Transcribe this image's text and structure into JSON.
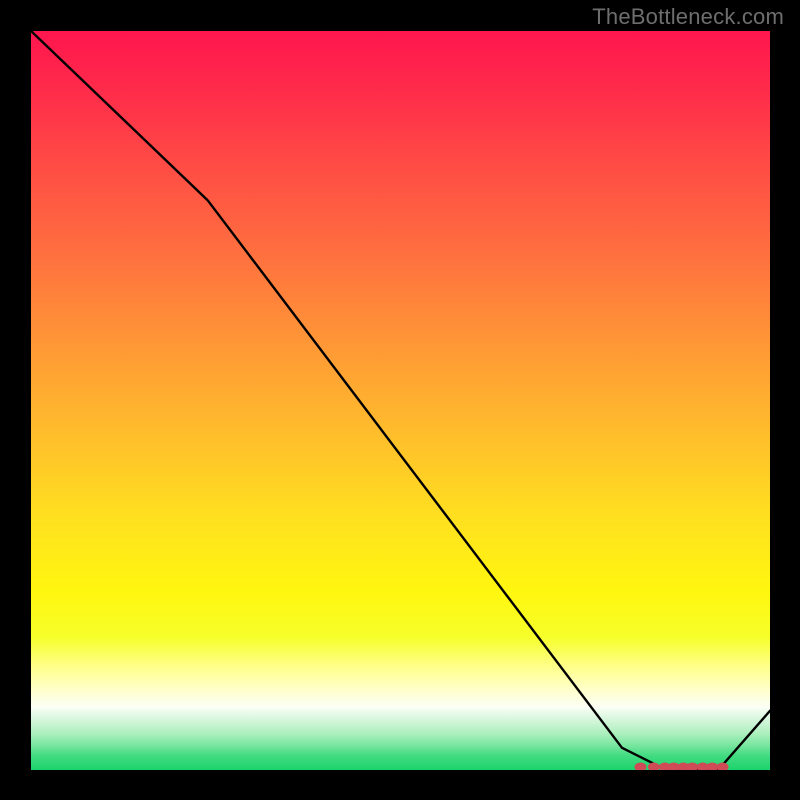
{
  "attribution": "TheBottleneck.com",
  "colors": {
    "gradient_stops": [
      {
        "offset": 0.0,
        "color": "#ff164e"
      },
      {
        "offset": 0.08,
        "color": "#ff2b4a"
      },
      {
        "offset": 0.18,
        "color": "#ff4b45"
      },
      {
        "offset": 0.3,
        "color": "#ff6f3f"
      },
      {
        "offset": 0.42,
        "color": "#ff9636"
      },
      {
        "offset": 0.55,
        "color": "#ffbf2b"
      },
      {
        "offset": 0.67,
        "color": "#ffe31e"
      },
      {
        "offset": 0.76,
        "color": "#fff70f"
      },
      {
        "offset": 0.82,
        "color": "#f6ff2a"
      },
      {
        "offset": 0.86,
        "color": "#ffff8a"
      },
      {
        "offset": 0.89,
        "color": "#ffffc8"
      },
      {
        "offset": 0.915,
        "color": "#fbfff6"
      },
      {
        "offset": 0.93,
        "color": "#d9f7df"
      },
      {
        "offset": 0.95,
        "color": "#aef0bf"
      },
      {
        "offset": 0.965,
        "color": "#7ee7a2"
      },
      {
        "offset": 0.98,
        "color": "#44db82"
      },
      {
        "offset": 1.0,
        "color": "#1bd46b"
      }
    ],
    "line": "#000000",
    "dot": "#cf4b55"
  },
  "chart_data": {
    "type": "line",
    "title": "",
    "xlabel": "",
    "ylabel": "",
    "xlim": [
      0,
      100
    ],
    "ylim": [
      0,
      100
    ],
    "x": [
      0,
      24,
      80,
      86,
      93,
      100
    ],
    "values": [
      100,
      77,
      3,
      0,
      0,
      8
    ],
    "optimal_band": {
      "x_start": 82,
      "x_end": 94,
      "y": 0,
      "dot_x": [
        82.5,
        84.3,
        85.8,
        87.0,
        88.3,
        89.5,
        90.9,
        92.2,
        93.6
      ]
    }
  }
}
